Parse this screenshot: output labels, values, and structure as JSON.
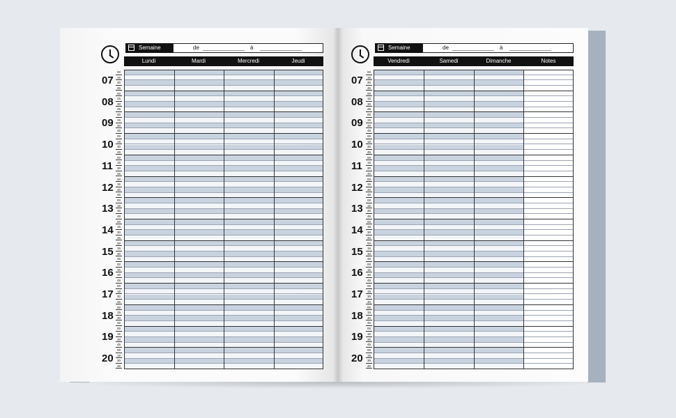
{
  "planner": {
    "week_label": "Semaine",
    "from_label": "de",
    "to_label": "à",
    "date_blank": "__/__/____",
    "left_days": [
      "Lundi",
      "Mardi",
      "Mercredi",
      "Jeudi"
    ],
    "right_days": [
      "Vendredi",
      "Samedi",
      "Dimanche",
      "Notes"
    ],
    "hours": [
      "07",
      "08",
      "09",
      "10",
      "11",
      "12",
      "13",
      "14",
      "15",
      "16",
      "17",
      "18",
      "19",
      "20"
    ],
    "minutes": [
      "00",
      "15",
      "30",
      "45"
    ]
  },
  "colors": {
    "background": "#e6e9ed",
    "header_black": "#111111",
    "row_blue": "#c9d3e0",
    "row_white": "#f3f5f8"
  }
}
